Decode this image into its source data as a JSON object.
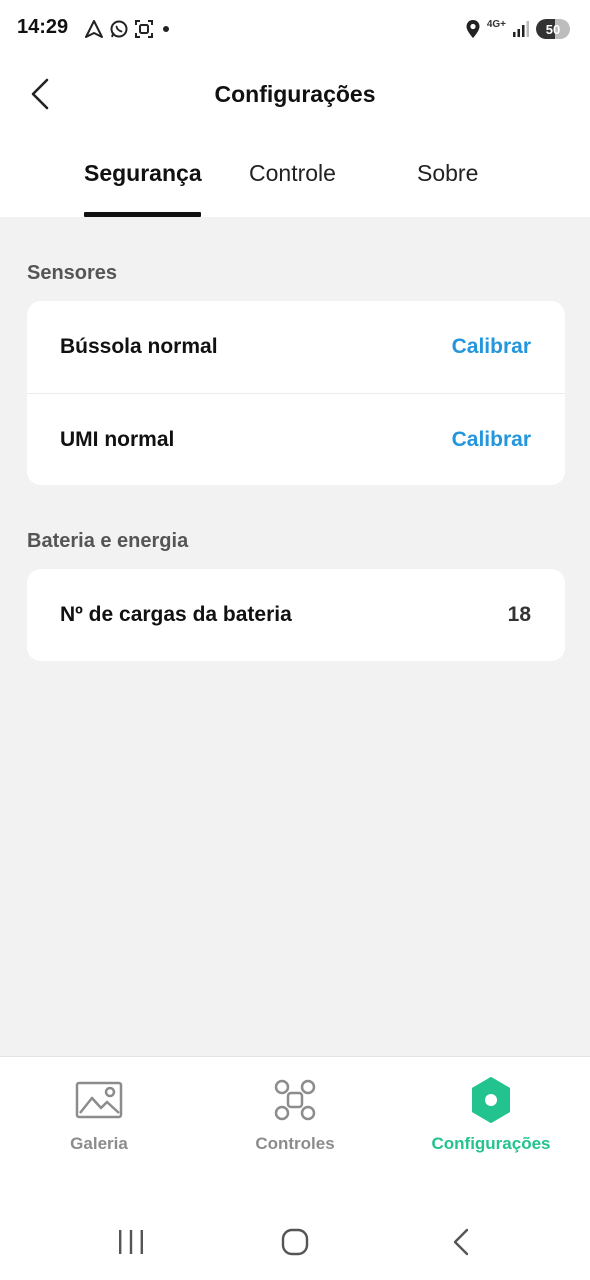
{
  "status_bar": {
    "time": "14:29",
    "network": "4G+",
    "battery": "50"
  },
  "header": {
    "title": "Configurações"
  },
  "tabs": [
    {
      "label": "Segurança",
      "active": true
    },
    {
      "label": "Controle",
      "active": false
    },
    {
      "label": "Sobre",
      "active": false
    }
  ],
  "sections": {
    "sensors": {
      "title": "Sensores",
      "rows": [
        {
          "label": "Bússola normal",
          "action": "Calibrar"
        },
        {
          "label": "UMI normal",
          "action": "Calibrar"
        }
      ]
    },
    "battery": {
      "title": "Bateria e energia",
      "rows": [
        {
          "label": "Nº de cargas da bateria",
          "value": "18"
        }
      ]
    }
  },
  "bottom_nav": [
    {
      "label": "Galeria",
      "icon": "gallery-icon",
      "active": false
    },
    {
      "label": "Controles",
      "icon": "drone-icon",
      "active": false
    },
    {
      "label": "Configurações",
      "icon": "settings-hexagon-icon",
      "active": true
    }
  ],
  "colors": {
    "accent_blue": "#2396dc",
    "accent_green": "#22c38e",
    "background": "#f2f2f2"
  }
}
